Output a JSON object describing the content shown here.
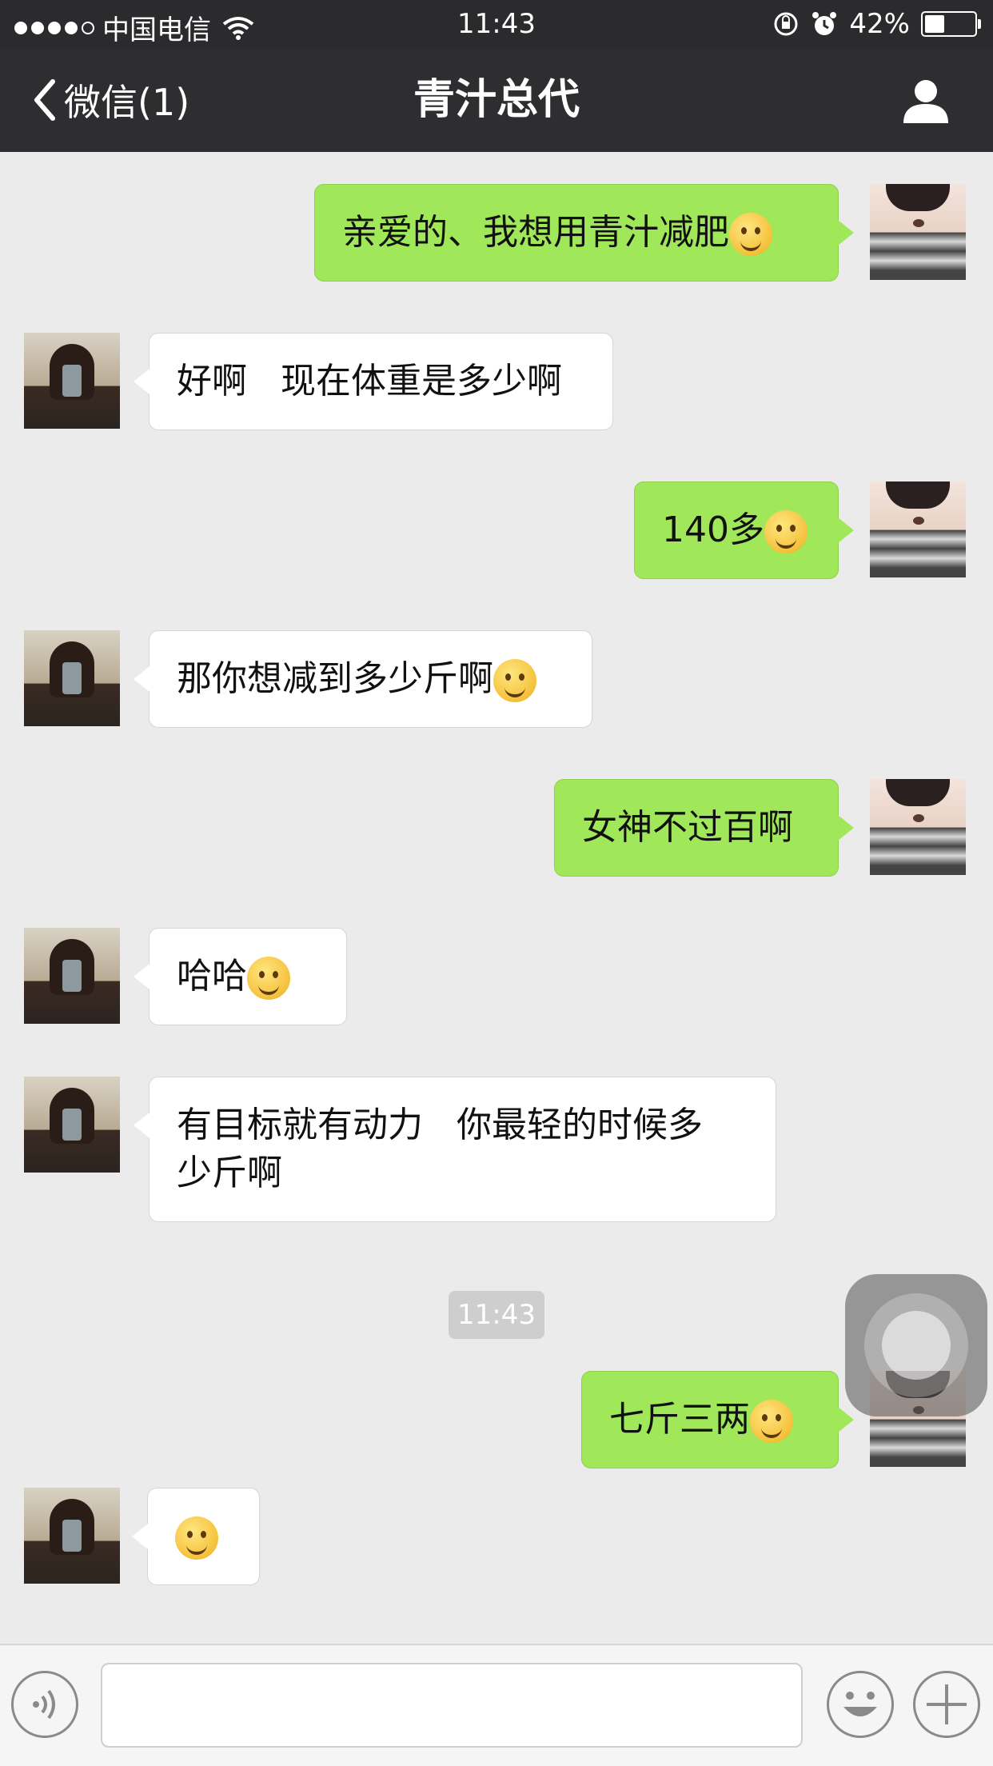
{
  "status_bar": {
    "carrier": "中国电信",
    "time": "11:43",
    "battery": "42%",
    "battery_level": 0.42
  },
  "nav": {
    "back_label": "微信(1)",
    "title": "青汁总代"
  },
  "messages": [
    {
      "side": "sent",
      "text": "亲爱的、我想用青汁减肥",
      "emoji": "blush-smile-emoji"
    },
    {
      "side": "recv",
      "text": "好啊   现在体重是多少啊",
      "emoji": ""
    },
    {
      "side": "sent",
      "text": "140多",
      "emoji": "pleading-emoji"
    },
    {
      "side": "recv",
      "text": "那你想减到多少斤啊",
      "emoji": "smile-emoji"
    },
    {
      "side": "sent",
      "text": "女神不过百啊",
      "emoji": ""
    },
    {
      "side": "recv",
      "text": "哈哈",
      "emoji": "grin-emoji"
    },
    {
      "side": "recv",
      "text": "有目标就有动力   你最轻的时候多\n少斤啊",
      "emoji": ""
    },
    {
      "side": "sent",
      "text": "七斤三两",
      "emoji": "tears-of-joy-emoji"
    },
    {
      "side": "recv",
      "text": "",
      "emoji": "thinking-emoji"
    }
  ],
  "timestamp": "11:43",
  "icons": {
    "back": "chevron-left-icon",
    "profile": "person-icon",
    "voice": "voice-icon",
    "sticker": "smiley-icon",
    "more": "plus-icon"
  },
  "colors": {
    "nav_bg": "#2e2e31",
    "sent_bubble": "#a0e75a",
    "recv_bubble": "#ffffff",
    "chat_bg": "#ebebeb"
  }
}
